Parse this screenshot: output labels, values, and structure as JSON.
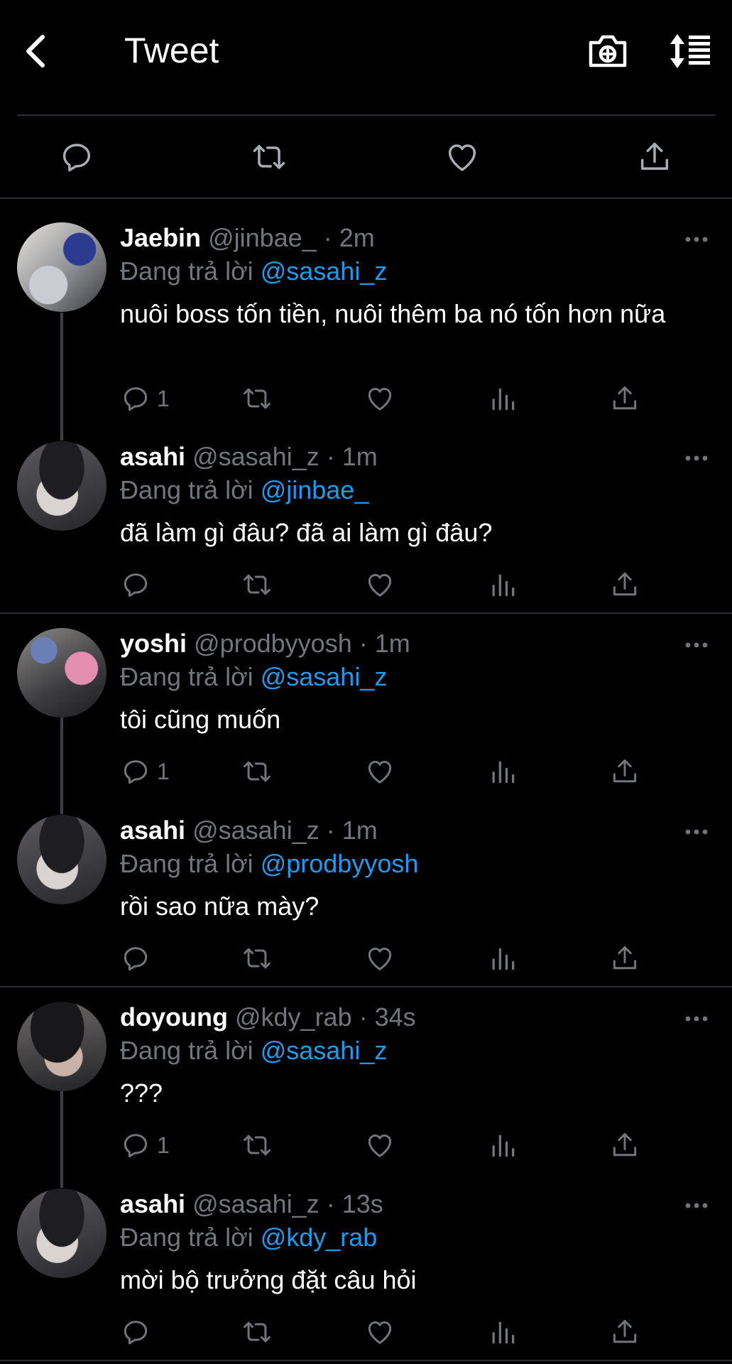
{
  "header": {
    "title": "Tweet"
  },
  "colors": {
    "background": "#000000",
    "muted": "#71767b",
    "mention": "#1d9bf0",
    "divider": "#2a2d31"
  },
  "icons": {
    "back": "chevron-left-icon",
    "camera": "camera-plus-icon",
    "sort": "sort-icon",
    "reply": "reply-icon",
    "retweet": "retweet-icon",
    "like": "heart-icon",
    "analytics": "analytics-icon",
    "share": "share-icon",
    "more": "more-icon"
  },
  "replying_prefix": "Đang trả lời",
  "tweets": [
    {
      "name": "Jaebin",
      "meta": "@jinbae_ · 2m",
      "mention": "@sasahi_z",
      "text": "nuôi boss tốn tiền, nuôi thêm ba nó tốn hơn nữa",
      "reply_count": "1"
    },
    {
      "name": "asahi",
      "meta": "@sasahi_z · 1m",
      "mention": "@jinbae_",
      "text": "đã làm gì đâu? đã ai làm gì đâu?",
      "reply_count": ""
    },
    {
      "name": "yoshi",
      "meta": "@prodbyyosh · 1m",
      "mention": "@sasahi_z",
      "text": "tôi cũng muốn",
      "reply_count": "1"
    },
    {
      "name": "asahi",
      "meta": "@sasahi_z · 1m",
      "mention": "@prodbyyosh",
      "text": "rồi sao nữa mày?",
      "reply_count": ""
    },
    {
      "name": "doyoung",
      "meta": "@kdy_rab · 34s",
      "mention": "@sasahi_z",
      "text": "???",
      "reply_count": "1"
    },
    {
      "name": "asahi",
      "meta": "@sasahi_z · 13s",
      "mention": "@kdy_rab",
      "text": "mời bộ trưởng đặt câu hỏi",
      "reply_count": ""
    }
  ]
}
